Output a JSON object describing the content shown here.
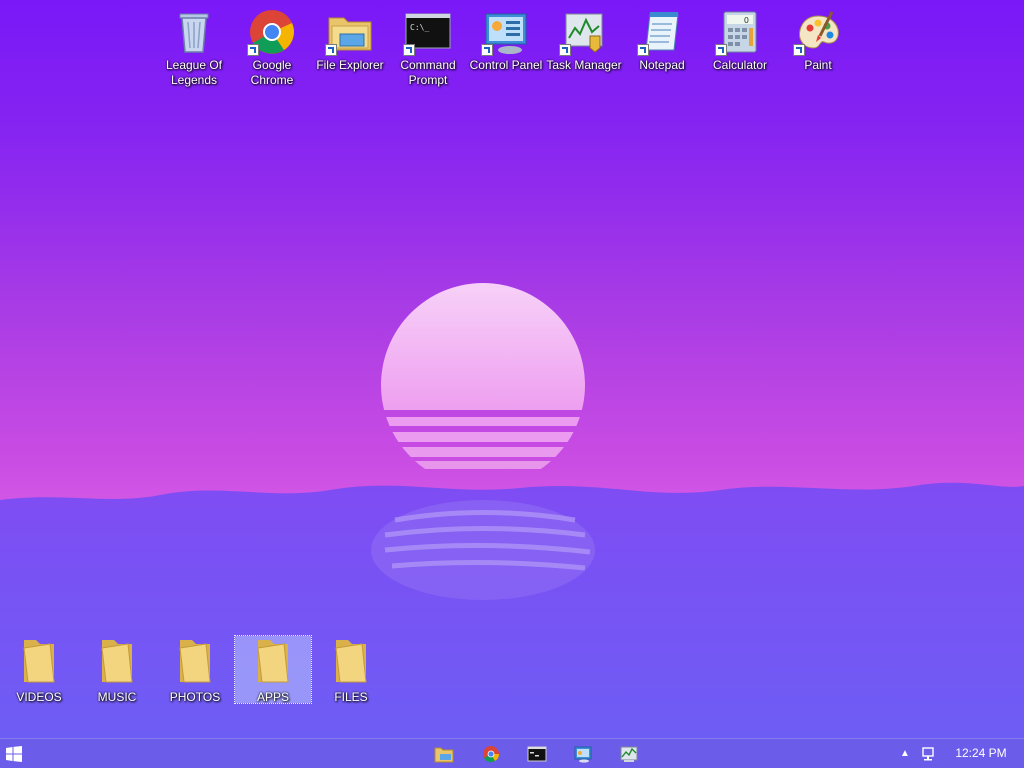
{
  "desktop_icons": [
    {
      "label_line1": "League Of",
      "label_line2": "Legends",
      "icon": "recycle-bin-icon"
    },
    {
      "label_line1": "Google",
      "label_line2": "Chrome",
      "icon": "chrome-icon"
    },
    {
      "label_line1": "File Explorer",
      "label_line2": "",
      "icon": "file-explorer-icon"
    },
    {
      "label_line1": "Command",
      "label_line2": "Prompt",
      "icon": "command-prompt-icon"
    },
    {
      "label_line1": "Control Panel",
      "label_line2": "",
      "icon": "control-panel-icon"
    },
    {
      "label_line1": "Task Manager",
      "label_line2": "",
      "icon": "task-manager-icon"
    },
    {
      "label_line1": "Notepad",
      "label_line2": "",
      "icon": "notepad-icon"
    },
    {
      "label_line1": "Calculator",
      "label_line2": "",
      "icon": "calculator-icon"
    },
    {
      "label_line1": "Paint",
      "label_line2": "",
      "icon": "paint-icon"
    }
  ],
  "folders": [
    {
      "label": "VIDEOS",
      "selected": false
    },
    {
      "label": "MUSIC",
      "selected": false
    },
    {
      "label": "PHOTOS",
      "selected": false
    },
    {
      "label": "APPS",
      "selected": true
    },
    {
      "label": "FILES",
      "selected": false
    }
  ],
  "taskbar": {
    "pinned": [
      "file-explorer-icon",
      "chrome-icon",
      "command-prompt-icon",
      "control-panel-icon",
      "task-manager-icon"
    ],
    "tray_arrow": "▲",
    "clock": "12:24 PM",
    "cmd_text": "C:\\_",
    "calc_digit": "0"
  },
  "colors": {
    "taskbar": "#6b5dea",
    "sun": "#f2c4f6",
    "accent": "#1e5fc1"
  }
}
